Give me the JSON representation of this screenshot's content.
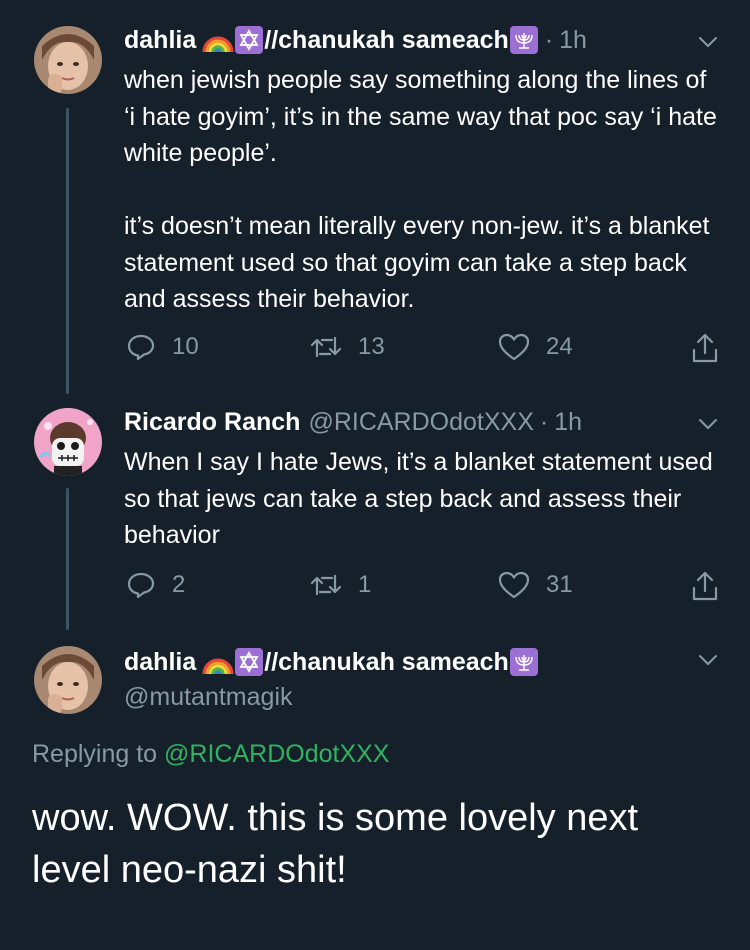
{
  "tweets": [
    {
      "display_name_prefix": "dahlia",
      "display_name_suffix": "//chanukah sameach",
      "time": "1h",
      "body": "when jewish people say something along the lines of ‘i hate goyim’, it’s in the same way that poc say ‘i hate white people’.\n\nit’s doesn’t mean literally every non-jew. it’s a blanket statement used so that goyim can take a step back and assess their behavior.",
      "replies": "10",
      "retweets": "13",
      "likes": "24"
    },
    {
      "display_name": "Ricardo Ranch",
      "handle": "@RICARDOdotXXX",
      "time": "1h",
      "body": "When I say I hate Jews, it’s a blanket statement used so that jews can take a step back and assess their behavior",
      "replies": "2",
      "retweets": "1",
      "likes": "31"
    }
  ],
  "main_tweet": {
    "display_name_prefix": "dahlia",
    "display_name_suffix": "//chanukah sameach",
    "handle": "@mutantmagik",
    "replying_prefix": "Replying to",
    "replying_to": "@RICARDOdotXXX",
    "body": "wow. WOW. this is some lovely next level neo-nazi shit!"
  },
  "icons": {
    "rainbow": "rainbow-emoji",
    "star_of_david": "star-of-david-emoji",
    "menorah": "menorah-emoji",
    "reply": "reply-icon",
    "retweet": "retweet-icon",
    "like": "heart-icon",
    "share": "share-icon",
    "chevron": "chevron-down-icon"
  },
  "colors": {
    "background": "#15202b",
    "secondary_text": "#8899a6",
    "emoji_purple": "#9b6fd3",
    "mention": "#2fb35f"
  }
}
